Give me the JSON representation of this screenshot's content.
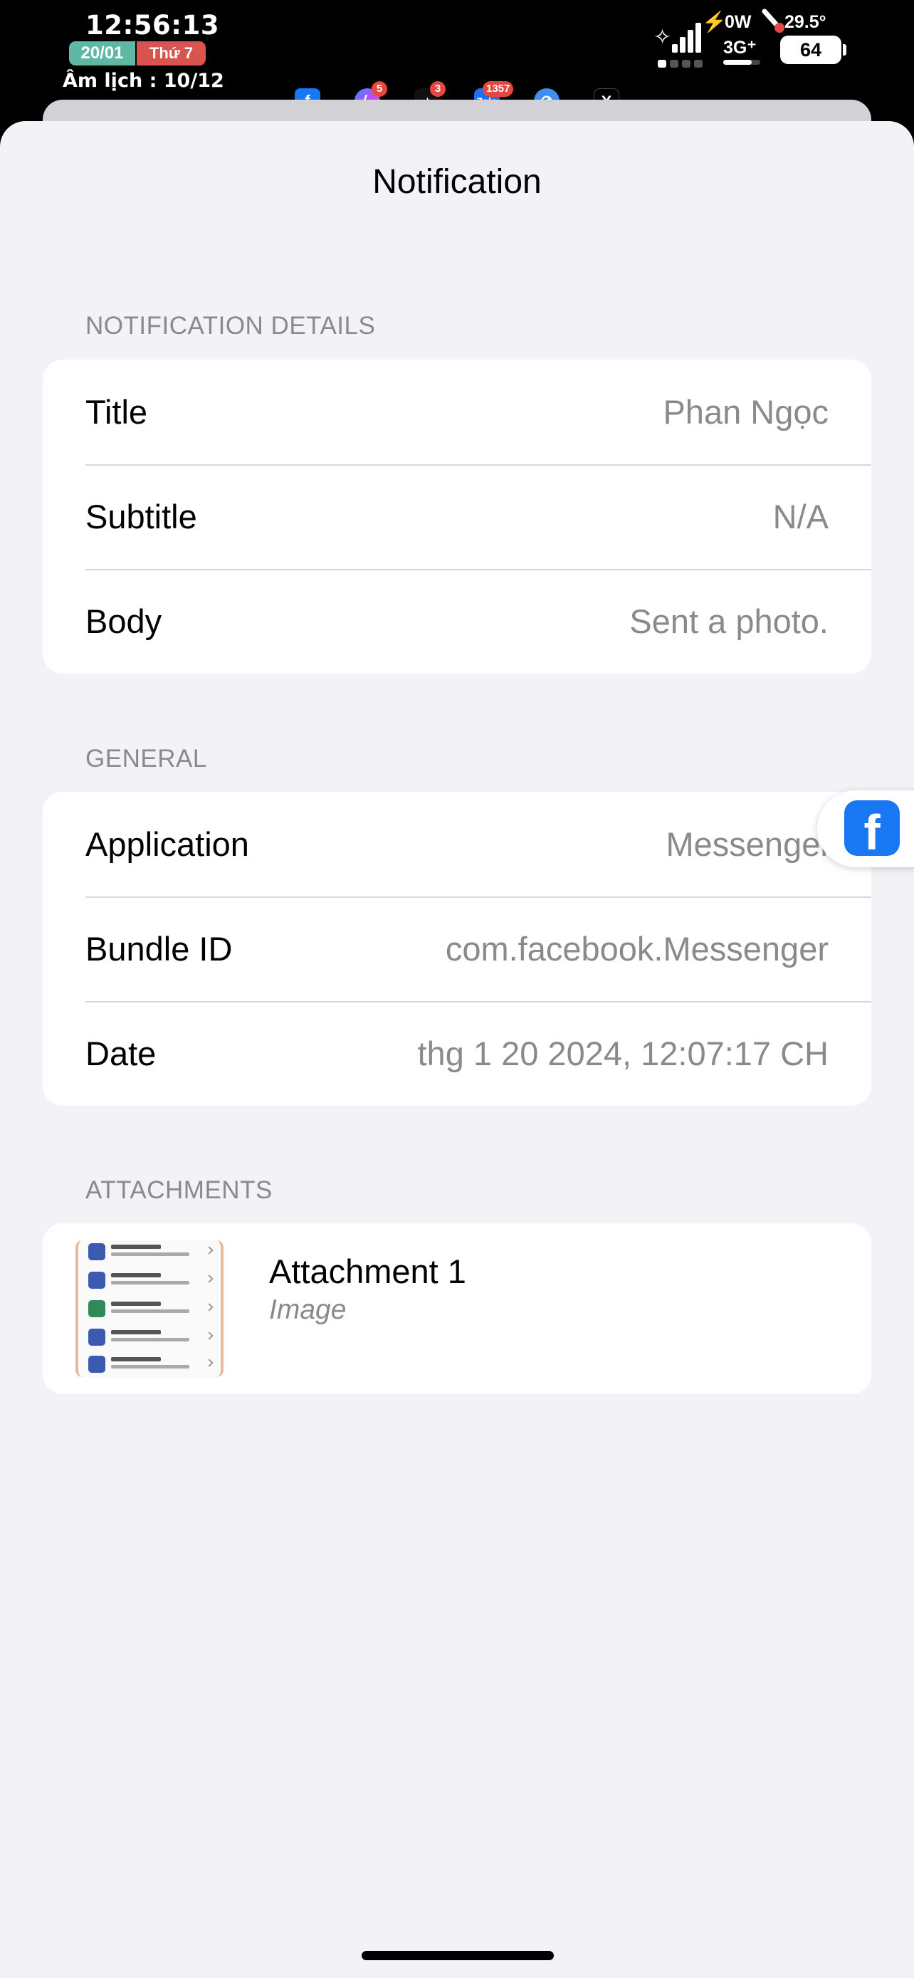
{
  "status_bar": {
    "time": "12:56:13",
    "date": "20/01",
    "weekday": "Thứ 7",
    "lunar": "Âm lịch : 10/12",
    "power": "0W",
    "temperature": "29.5°",
    "network": "3G⁺",
    "battery": "64"
  },
  "recent_apps": [
    {
      "name": "facebook-app-icon",
      "badge": ""
    },
    {
      "name": "messenger-app-icon",
      "badge": "5"
    },
    {
      "name": "tiktok-app-icon",
      "badge": "3"
    },
    {
      "name": "zalo-app-icon",
      "badge": "1357"
    },
    {
      "name": "safari-app-icon",
      "badge": ""
    },
    {
      "name": "x-app-icon",
      "badge": ""
    }
  ],
  "nav": {
    "title": "Notification"
  },
  "sections": {
    "details": {
      "header": "NOTIFICATION DETAILS",
      "rows": [
        {
          "label": "Title",
          "value": "Phan Ngọc"
        },
        {
          "label": "Subtitle",
          "value": "N/A"
        },
        {
          "label": "Body",
          "value": "Sent a photo."
        }
      ]
    },
    "general": {
      "header": "GENERAL",
      "rows": [
        {
          "label": "Application",
          "value": "Messenger"
        },
        {
          "label": "Bundle ID",
          "value": "com.facebook.Messenger"
        },
        {
          "label": "Date",
          "value": "thg 1 20 2024, 12:07:17 CH"
        }
      ]
    },
    "attachments": {
      "header": "ATTACHMENTS",
      "items": [
        {
          "title": "Attachment 1",
          "type": "Image"
        }
      ]
    }
  },
  "colors": {
    "background": "#f2f2f7",
    "card": "#ffffff",
    "secondary_text": "#8a8a8e",
    "facebook_blue": "#1877f2"
  }
}
